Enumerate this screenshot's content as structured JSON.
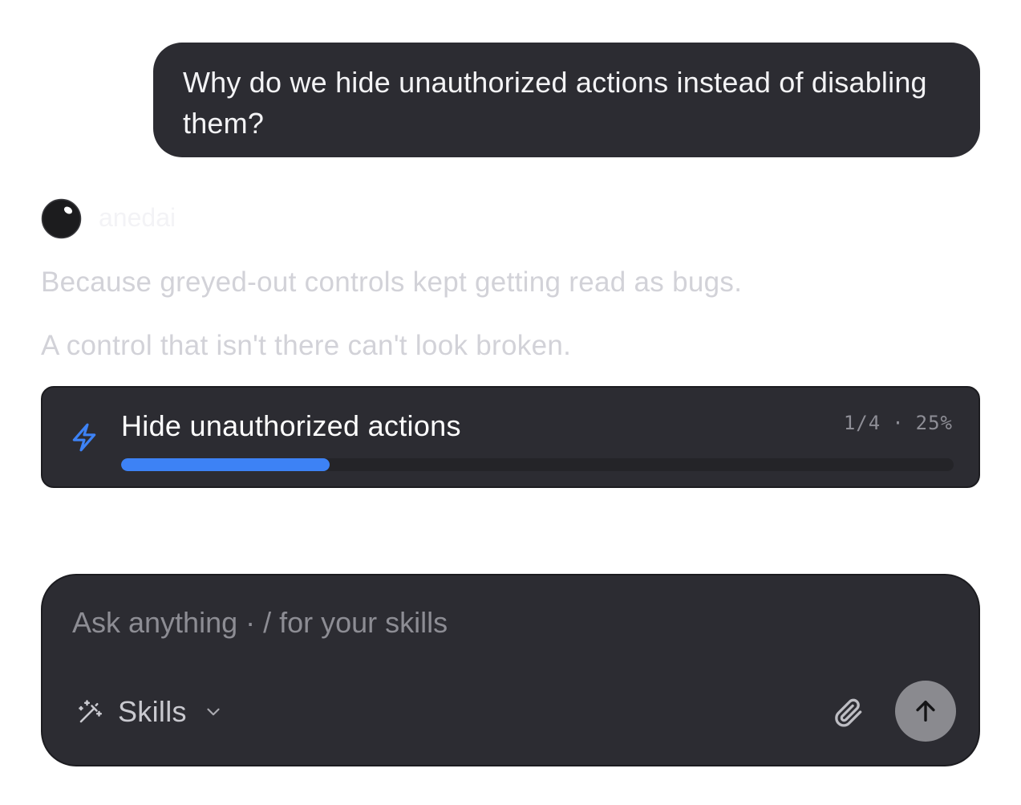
{
  "conversation": {
    "user_message": "Why do we hide unauthorized actions instead of disabling them?",
    "assistant": {
      "name": "anedai",
      "avatar_icon": "black-orb-icon",
      "lines": [
        "Because greyed-out controls kept getting read as bugs.",
        "A control that isn't there can't look broken."
      ]
    }
  },
  "task_card": {
    "icon": "lightning-bolt-icon",
    "title": "Hide unauthorized actions",
    "step": "1/4",
    "separator": "·",
    "percent_label": "25%",
    "progress": 0.25,
    "accent_color": "#3d82f5"
  },
  "composer": {
    "placeholder": "Ask anything · / for your skills",
    "value": "",
    "skills_label": "Skills",
    "skills_icon": "magic-wand-icon",
    "dropdown_icon": "chevron-down-icon",
    "attach_icon": "paperclip-icon",
    "send_icon": "arrow-up-icon"
  }
}
